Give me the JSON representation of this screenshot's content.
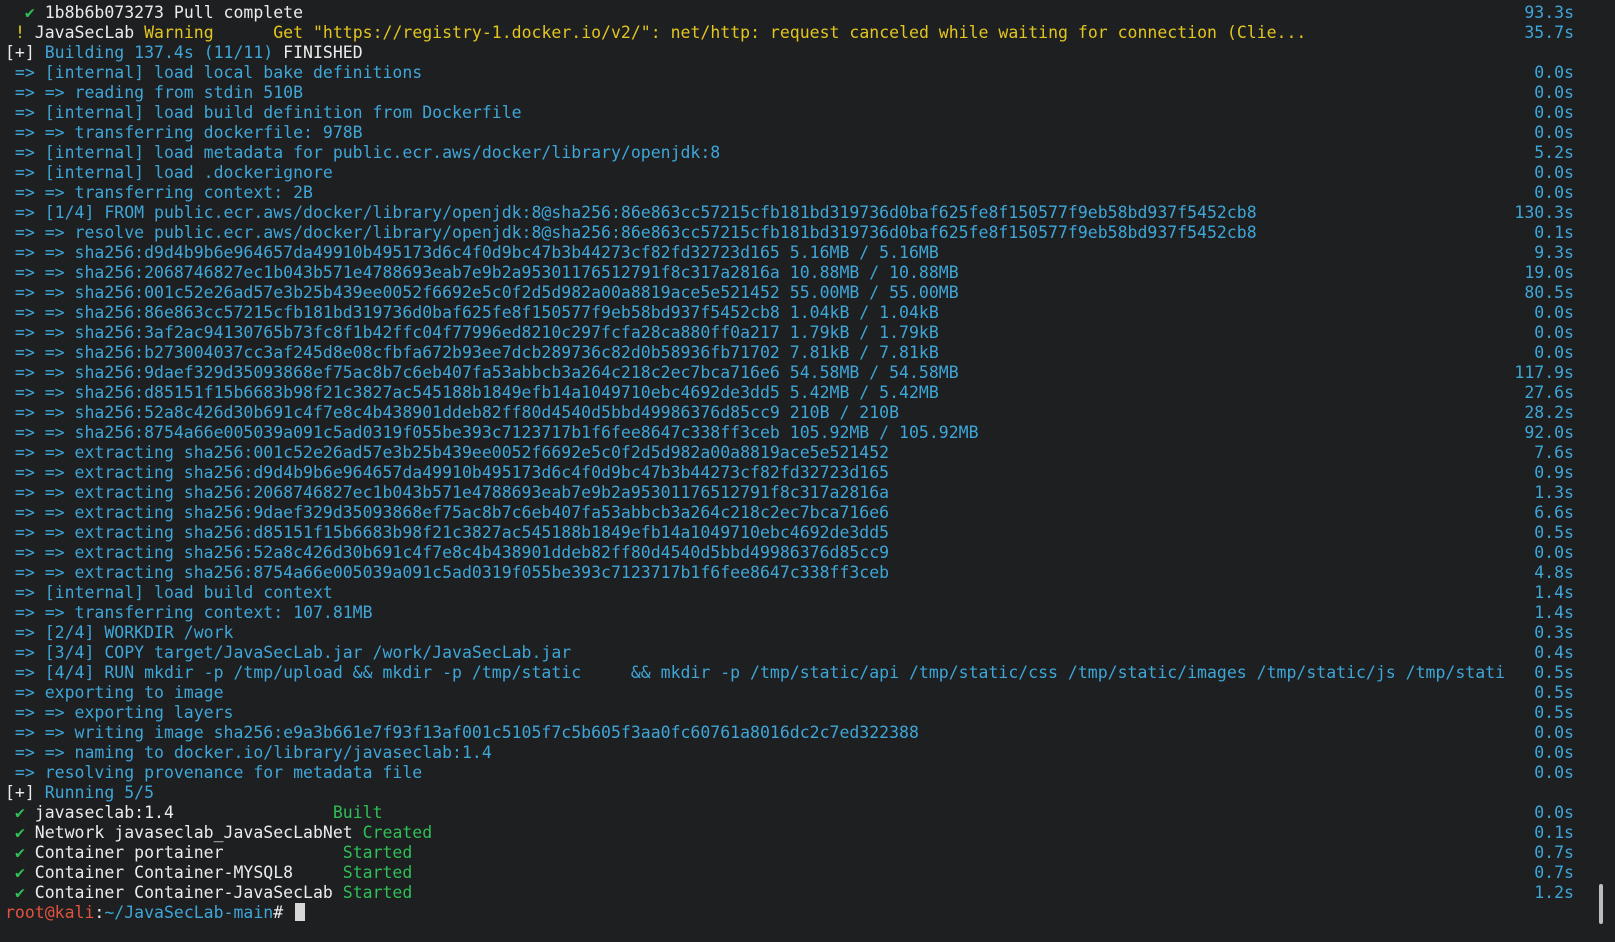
{
  "terminal": {
    "lines": [
      {
        "parts": [
          {
            "t": "  ",
            "c": "white"
          },
          {
            "t": "✔",
            "c": "green"
          },
          {
            "t": " 1b8b6b073273 Pull complete",
            "c": "white"
          }
        ],
        "time": "93.3s"
      },
      {
        "parts": [
          {
            "t": " ",
            "c": "white"
          },
          {
            "t": "!",
            "c": "yellow"
          },
          {
            "t": " JavaSecLab ",
            "c": "white"
          },
          {
            "t": "Warning",
            "c": "yellow"
          },
          {
            "t": "      Get \"https://registry-1.docker.io/v2/\": net/http: request canceled while waiting for connection (Clie...",
            "c": "yellow"
          }
        ],
        "time": "35.7s"
      },
      {
        "parts": [
          {
            "t": "[+] ",
            "c": "white"
          },
          {
            "t": "Building 137.4s (11/11) ",
            "c": "blue"
          },
          {
            "t": "FINISHED",
            "c": "white"
          }
        ],
        "time": ""
      },
      {
        "parts": [
          {
            "t": " => [internal] load local bake definitions",
            "c": "blue"
          }
        ],
        "time": "0.0s"
      },
      {
        "parts": [
          {
            "t": " => => reading from stdin 510B",
            "c": "blue"
          }
        ],
        "time": "0.0s"
      },
      {
        "parts": [
          {
            "t": " => [internal] load build definition from Dockerfile",
            "c": "blue"
          }
        ],
        "time": "0.0s"
      },
      {
        "parts": [
          {
            "t": " => => transferring dockerfile: 978B",
            "c": "blue"
          }
        ],
        "time": "0.0s"
      },
      {
        "parts": [
          {
            "t": " => [internal] load metadata for public.ecr.aws/docker/library/openjdk:8",
            "c": "blue"
          }
        ],
        "time": "5.2s"
      },
      {
        "parts": [
          {
            "t": " => [internal] load .dockerignore",
            "c": "blue"
          }
        ],
        "time": "0.0s"
      },
      {
        "parts": [
          {
            "t": " => => transferring context: 2B",
            "c": "blue"
          }
        ],
        "time": "0.0s"
      },
      {
        "parts": [
          {
            "t": " => [1/4] FROM public.ecr.aws/docker/library/openjdk:8@sha256:86e863cc57215cfb181bd319736d0baf625fe8f150577f9eb58bd937f5452cb8",
            "c": "blue"
          }
        ],
        "time": "130.3s"
      },
      {
        "parts": [
          {
            "t": " => => resolve public.ecr.aws/docker/library/openjdk:8@sha256:86e863cc57215cfb181bd319736d0baf625fe8f150577f9eb58bd937f5452cb8",
            "c": "blue"
          }
        ],
        "time": "0.1s"
      },
      {
        "parts": [
          {
            "t": " => => sha256:d9d4b9b6e964657da49910b495173d6c4f0d9bc47b3b44273cf82fd32723d165 5.16MB / 5.16MB",
            "c": "blue"
          }
        ],
        "time": "9.3s"
      },
      {
        "parts": [
          {
            "t": " => => sha256:2068746827ec1b043b571e4788693eab7e9b2a95301176512791f8c317a2816a 10.88MB / 10.88MB",
            "c": "blue"
          }
        ],
        "time": "19.0s"
      },
      {
        "parts": [
          {
            "t": " => => sha256:001c52e26ad57e3b25b439ee0052f6692e5c0f2d5d982a00a8819ace5e521452 55.00MB / 55.00MB",
            "c": "blue"
          }
        ],
        "time": "80.5s"
      },
      {
        "parts": [
          {
            "t": " => => sha256:86e863cc57215cfb181bd319736d0baf625fe8f150577f9eb58bd937f5452cb8 1.04kB / 1.04kB",
            "c": "blue"
          }
        ],
        "time": "0.0s"
      },
      {
        "parts": [
          {
            "t": " => => sha256:3af2ac94130765b73fc8f1b42ffc04f77996ed8210c297fcfa28ca880ff0a217 1.79kB / 1.79kB",
            "c": "blue"
          }
        ],
        "time": "0.0s"
      },
      {
        "parts": [
          {
            "t": " => => sha256:b273004037cc3af245d8e08cfbfa672b93ee7dcb289736c82d0b58936fb71702 7.81kB / 7.81kB",
            "c": "blue"
          }
        ],
        "time": "0.0s"
      },
      {
        "parts": [
          {
            "t": " => => sha256:9daef329d35093868ef75ac8b7c6eb407fa53abbcb3a264c218c2ec7bca716e6 54.58MB / 54.58MB",
            "c": "blue"
          }
        ],
        "time": "117.9s"
      },
      {
        "parts": [
          {
            "t": " => => sha256:d85151f15b6683b98f21c3827ac545188b1849efb14a1049710ebc4692de3dd5 5.42MB / 5.42MB",
            "c": "blue"
          }
        ],
        "time": "27.6s"
      },
      {
        "parts": [
          {
            "t": " => => sha256:52a8c426d30b691c4f7e8c4b438901ddeb82ff80d4540d5bbd49986376d85cc9 210B / 210B",
            "c": "blue"
          }
        ],
        "time": "28.2s"
      },
      {
        "parts": [
          {
            "t": " => => sha256:8754a66e005039a091c5ad0319f055be393c7123717b1f6fee8647c338ff3ceb 105.92MB / 105.92MB",
            "c": "blue"
          }
        ],
        "time": "92.0s"
      },
      {
        "parts": [
          {
            "t": " => => extracting sha256:001c52e26ad57e3b25b439ee0052f6692e5c0f2d5d982a00a8819ace5e521452",
            "c": "blue"
          }
        ],
        "time": "7.6s"
      },
      {
        "parts": [
          {
            "t": " => => extracting sha256:d9d4b9b6e964657da49910b495173d6c4f0d9bc47b3b44273cf82fd32723d165",
            "c": "blue"
          }
        ],
        "time": "0.9s"
      },
      {
        "parts": [
          {
            "t": " => => extracting sha256:2068746827ec1b043b571e4788693eab7e9b2a95301176512791f8c317a2816a",
            "c": "blue"
          }
        ],
        "time": "1.3s"
      },
      {
        "parts": [
          {
            "t": " => => extracting sha256:9daef329d35093868ef75ac8b7c6eb407fa53abbcb3a264c218c2ec7bca716e6",
            "c": "blue"
          }
        ],
        "time": "6.6s"
      },
      {
        "parts": [
          {
            "t": " => => extracting sha256:d85151f15b6683b98f21c3827ac545188b1849efb14a1049710ebc4692de3dd5",
            "c": "blue"
          }
        ],
        "time": "0.5s"
      },
      {
        "parts": [
          {
            "t": " => => extracting sha256:52a8c426d30b691c4f7e8c4b438901ddeb82ff80d4540d5bbd49986376d85cc9",
            "c": "blue"
          }
        ],
        "time": "0.0s"
      },
      {
        "parts": [
          {
            "t": " => => extracting sha256:8754a66e005039a091c5ad0319f055be393c7123717b1f6fee8647c338ff3ceb",
            "c": "blue"
          }
        ],
        "time": "4.8s"
      },
      {
        "parts": [
          {
            "t": " => [internal] load build context",
            "c": "blue"
          }
        ],
        "time": "1.4s"
      },
      {
        "parts": [
          {
            "t": " => => transferring context: 107.81MB",
            "c": "blue"
          }
        ],
        "time": "1.4s"
      },
      {
        "parts": [
          {
            "t": " => [2/4] WORKDIR /work",
            "c": "blue"
          }
        ],
        "time": "0.3s"
      },
      {
        "parts": [
          {
            "t": " => [3/4] COPY target/JavaSecLab.jar /work/JavaSecLab.jar",
            "c": "blue"
          }
        ],
        "time": "0.4s"
      },
      {
        "parts": [
          {
            "t": " => [4/4] RUN mkdir -p /tmp/upload && mkdir -p /tmp/static     && mkdir -p /tmp/static/api /tmp/static/css /tmp/static/images /tmp/static/js /tmp/stati",
            "c": "blue"
          }
        ],
        "time": "0.5s"
      },
      {
        "parts": [
          {
            "t": " => exporting to image",
            "c": "blue"
          }
        ],
        "time": "0.5s"
      },
      {
        "parts": [
          {
            "t": " => => exporting layers",
            "c": "blue"
          }
        ],
        "time": "0.5s"
      },
      {
        "parts": [
          {
            "t": " => => writing image sha256:e9a3b661e7f93f13af001c5105f7c5b605f3aa0fc60761a8016dc2c7ed322388",
            "c": "blue"
          }
        ],
        "time": "0.0s"
      },
      {
        "parts": [
          {
            "t": " => => naming to docker.io/library/javaseclab:1.4",
            "c": "blue"
          }
        ],
        "time": "0.0s"
      },
      {
        "parts": [
          {
            "t": " => resolving provenance for metadata file",
            "c": "blue"
          }
        ],
        "time": "0.0s"
      },
      {
        "parts": [
          {
            "t": "[+] ",
            "c": "white"
          },
          {
            "t": "Running 5/5",
            "c": "blue"
          }
        ],
        "time": ""
      },
      {
        "parts": [
          {
            "t": " ",
            "c": "white"
          },
          {
            "t": "✔",
            "c": "green"
          },
          {
            "t": " javaseclab:1.4                ",
            "c": "white"
          },
          {
            "t": "Built",
            "c": "green"
          }
        ],
        "time": "0.0s"
      },
      {
        "parts": [
          {
            "t": " ",
            "c": "white"
          },
          {
            "t": "✔",
            "c": "green"
          },
          {
            "t": " Network javaseclab_JavaSecLabNet ",
            "c": "white"
          },
          {
            "t": "Created",
            "c": "green"
          }
        ],
        "time": "0.1s"
      },
      {
        "parts": [
          {
            "t": " ",
            "c": "white"
          },
          {
            "t": "✔",
            "c": "green"
          },
          {
            "t": " Container portainer            ",
            "c": "white"
          },
          {
            "t": "Started",
            "c": "green"
          }
        ],
        "time": "0.7s"
      },
      {
        "parts": [
          {
            "t": " ",
            "c": "white"
          },
          {
            "t": "✔",
            "c": "green"
          },
          {
            "t": " Container Container-MYSQL8     ",
            "c": "white"
          },
          {
            "t": "Started",
            "c": "green"
          }
        ],
        "time": "0.7s"
      },
      {
        "parts": [
          {
            "t": " ",
            "c": "white"
          },
          {
            "t": "✔",
            "c": "green"
          },
          {
            "t": " Container Container-JavaSecLab ",
            "c": "white"
          },
          {
            "t": "Started",
            "c": "green"
          }
        ],
        "time": "1.2s"
      }
    ],
    "prompt": {
      "user_host": "root@kali",
      "separator": ":",
      "path": "~/JavaSecLab-main",
      "symbol": "# "
    }
  },
  "colors": {
    "background": "#1d1f21",
    "blue": "#3fa6d8",
    "green": "#2fbf56",
    "yellow": "#e3c51f",
    "red": "#e2533f",
    "white": "#ececec"
  }
}
